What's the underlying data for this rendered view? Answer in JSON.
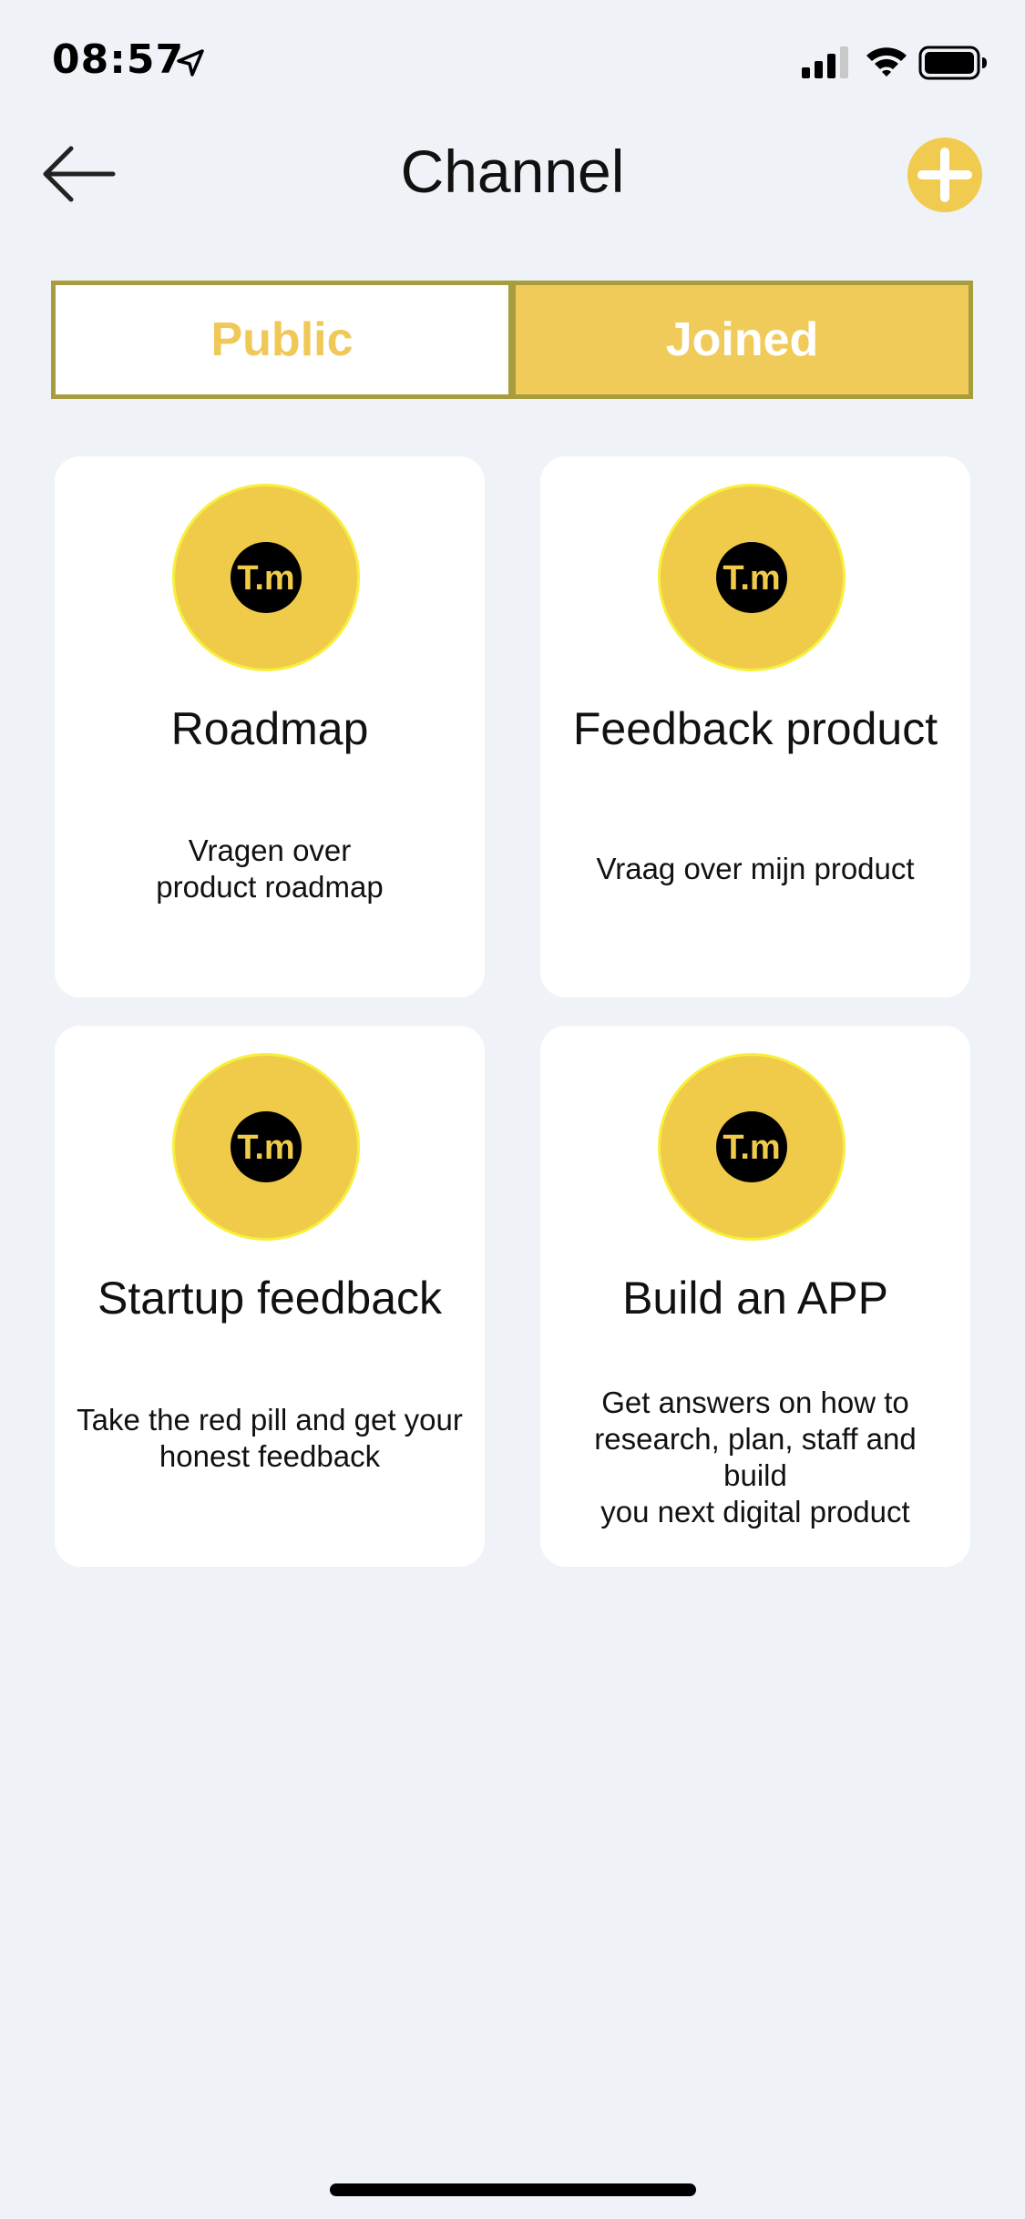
{
  "status_bar": {
    "time": "08:57"
  },
  "header": {
    "title": "Channel",
    "back_icon": "arrow-left-icon",
    "add_icon": "plus-icon"
  },
  "tabs": [
    {
      "label": "Public",
      "active": false
    },
    {
      "label": "Joined",
      "active": true
    }
  ],
  "channels": [
    {
      "title": "Roadmap",
      "description_lines": [
        "Vragen over",
        "product roadmap"
      ],
      "logo_text": "T.m"
    },
    {
      "title": "Feedback product",
      "description_lines": [
        "Vraag over mijn product"
      ],
      "logo_text": "T.m"
    },
    {
      "title": "Startup feedback",
      "description_lines": [
        "Take the red pill and get your",
        "honest feedback"
      ],
      "logo_text": "T.m"
    },
    {
      "title": "Build an APP",
      "description_lines": [
        "Get answers on how to",
        "research, plan, staff and build",
        "you next digital product"
      ],
      "logo_text": "T.m"
    }
  ],
  "colors": {
    "accent": "#f0cb50",
    "tab_border": "#a89d3e",
    "background": "#eff2f7"
  }
}
